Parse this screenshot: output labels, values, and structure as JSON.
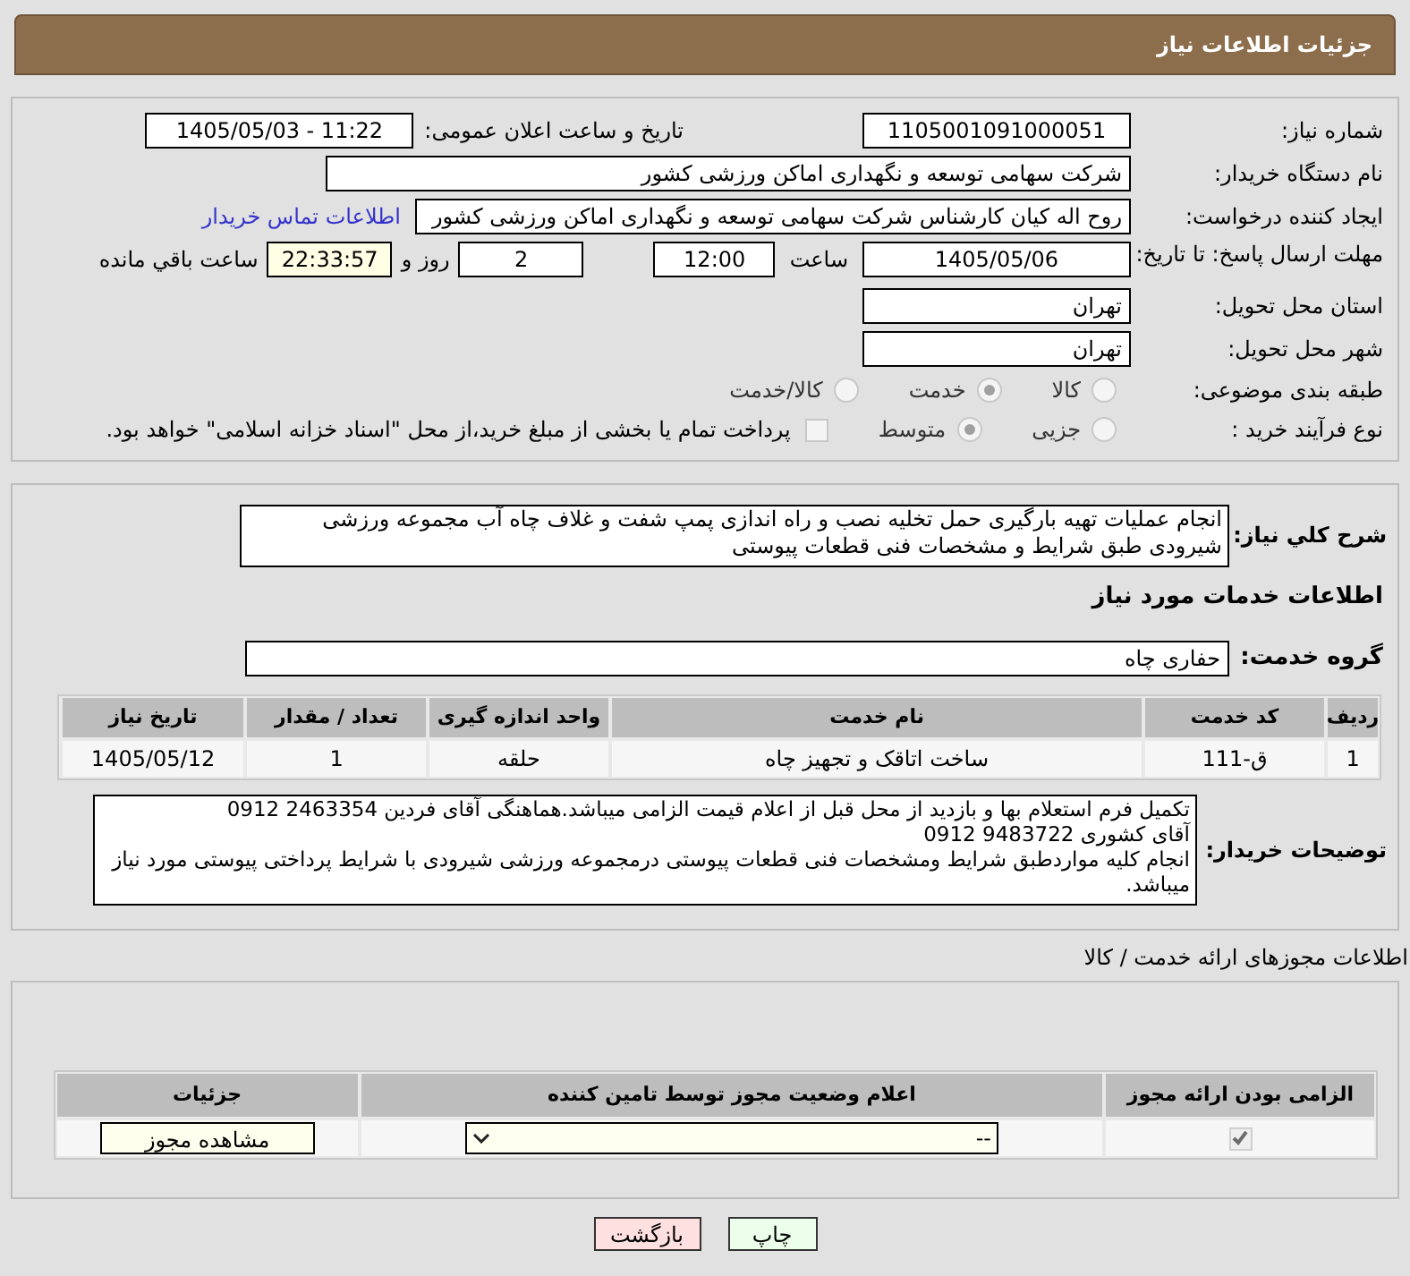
{
  "header": {
    "title": "جزئیات اطلاعات نیاز"
  },
  "need_info": {
    "need_number": {
      "label": "شماره نیاز:",
      "value": "1105001091000051"
    },
    "announce": {
      "label": "تاریخ و ساعت اعلان عمومی:",
      "value": "1405/05/03 - 11:22"
    },
    "buyer": {
      "label": "نام دستگاه خریدار:",
      "value": "شرکت سهامی توسعه و نگهداری اماکن ورزشی کشور"
    },
    "creator": {
      "label": "ایجاد کننده درخواست:",
      "value": "روح اله کیان کارشناس شرکت سهامی توسعه و نگهداری اماکن ورزشی کشور",
      "link": "اطلاعات تماس خریدار"
    },
    "deadline": {
      "label": "مهلت ارسال پاسخ: تا تاریخ:",
      "date": "1405/05/06",
      "time_label": "ساعت",
      "time": "12:00",
      "days": "2",
      "days_label": "روز و",
      "remaining": "22:33:57",
      "remaining_label": "ساعت باقي مانده"
    },
    "province": {
      "label": "استان محل تحویل:",
      "value": "تهران"
    },
    "city": {
      "label": "شهر محل تحویل:",
      "value": "تهران"
    },
    "category": {
      "label": "طبقه بندی موضوعی:",
      "options": [
        {
          "label": "کالا",
          "selected": false
        },
        {
          "label": "خدمت",
          "selected": true
        },
        {
          "label": "کالا/خدمت",
          "selected": false
        }
      ]
    },
    "process": {
      "label": "نوع فرآیند خرید :",
      "options": [
        {
          "label": "جزیی",
          "selected": false
        },
        {
          "label": "متوسط",
          "selected": true
        }
      ],
      "treasury": {
        "label": "پرداخت تمام یا بخشی از مبلغ خرید،از محل \"اسناد خزانه اسلامی\" خواهد بود.",
        "checked": false
      }
    }
  },
  "description": {
    "label": "شرح کلي نياز:",
    "value": "انجام عملیات تهیه بارگیری حمل تخلیه نصب و راه اندازی پمپ شفت و غلاف چاه آب مجموعه ورزشی شیرودی طبق شرایط و مشخصات فنی قطعات پیوستی"
  },
  "services": {
    "title": "اطلاعات خدمات مورد نیاز",
    "group": {
      "label": "گروه خدمت:",
      "value": "حفاری چاه"
    },
    "table": {
      "columns": [
        "ردیف",
        "کد خدمت",
        "نام خدمت",
        "واحد اندازه گیری",
        "تعداد / مقدار",
        "تاریخ نیاز"
      ],
      "rows": [
        [
          "1",
          "ق-111",
          "ساخت اتاقک و تجهیز چاه",
          "حلقه",
          "1",
          "1405/05/12"
        ]
      ]
    }
  },
  "buyer_notes": {
    "label": "توضیحات خریدار:",
    "value": "تکمیل فرم استعلام بها و بازدید از محل قبل از اعلام قیمت الزامی میباشد.هماهنگی آقای فردین 2463354 0912\nآقای کشوری 9483722 0912\nانجام کلیه مواردطبق شرایط ومشخصات فنی قطعات پیوستی درمجموعه ورزشی شیرودی با شرایط پرداختی پیوستی مورد نیاز میباشد."
  },
  "permits": {
    "title": "اطلاعات مجوزهای ارائه خدمت / کالا",
    "table": {
      "columns": [
        "الزامی بودن ارائه مجوز",
        "اعلام وضعیت مجوز توسط تامین کننده",
        "جزئیات"
      ],
      "rows": [
        {
          "required": true,
          "status": "--",
          "details_button": "مشاهده مجوز"
        }
      ]
    }
  },
  "buttons": [
    {
      "label": "چاپ",
      "kind": "print"
    },
    {
      "label": "بازگشت",
      "kind": "back"
    }
  ]
}
